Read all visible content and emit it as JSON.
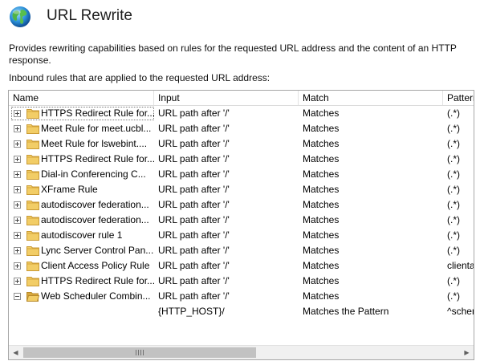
{
  "header": {
    "title": "URL Rewrite"
  },
  "description": "Provides rewriting capabilities based on rules for the requested URL address and the content of an HTTP response.",
  "inbound_label": "Inbound rules that are applied to the requested URL address:",
  "columns": {
    "name": "Name",
    "input": "Input",
    "match": "Match",
    "pattern": "Pattern"
  },
  "rules": [
    {
      "name": "HTTPS Redirect Rule for...",
      "input": "URL path after '/'",
      "match": "Matches",
      "pattern": "(.*)",
      "expander": "plus",
      "selected": true
    },
    {
      "name": "Meet Rule for meet.ucbl...",
      "input": "URL path after '/'",
      "match": "Matches",
      "pattern": "(.*)",
      "expander": "plus"
    },
    {
      "name": "Meet Rule for lswebint....",
      "input": "URL path after '/'",
      "match": "Matches",
      "pattern": "(.*)",
      "expander": "plus"
    },
    {
      "name": "HTTPS Redirect Rule for...",
      "input": "URL path after '/'",
      "match": "Matches",
      "pattern": "(.*)",
      "expander": "plus"
    },
    {
      "name": "Dial-in Conferencing C...",
      "input": "URL path after '/'",
      "match": "Matches",
      "pattern": "(.*)",
      "expander": "plus"
    },
    {
      "name": "XFrame Rule",
      "input": "URL path after '/'",
      "match": "Matches",
      "pattern": "(.*)",
      "expander": "plus"
    },
    {
      "name": "autodiscover federation...",
      "input": "URL path after '/'",
      "match": "Matches",
      "pattern": "(.*)",
      "expander": "plus"
    },
    {
      "name": "autodiscover federation...",
      "input": "URL path after '/'",
      "match": "Matches",
      "pattern": "(.*)",
      "expander": "plus"
    },
    {
      "name": "autodiscover rule 1",
      "input": "URL path after '/'",
      "match": "Matches",
      "pattern": "(.*)",
      "expander": "plus"
    },
    {
      "name": "Lync Server Control Pan...",
      "input": "URL path after '/'",
      "match": "Matches",
      "pattern": "(.*)",
      "expander": "plus"
    },
    {
      "name": "Client Access Policy Rule",
      "input": "URL path after '/'",
      "match": "Matches",
      "pattern": "clienta",
      "expander": "plus"
    },
    {
      "name": "HTTPS Redirect Rule for...",
      "input": "URL path after '/'",
      "match": "Matches",
      "pattern": "(.*)",
      "expander": "plus"
    },
    {
      "name": "Web Scheduler Combin...",
      "input": "URL path after '/'",
      "match": "Matches",
      "pattern": "(.*)",
      "expander": "minus",
      "open": true
    }
  ],
  "condition_row": {
    "input": "{HTTP_HOST}/",
    "match": "Matches the Pattern",
    "pattern": "^schem"
  },
  "colors": {
    "folder": "#f2cd66",
    "folder_dark": "#d7a73c",
    "thumb": "#c2c2c2"
  },
  "icons": {
    "header": "globe-icon",
    "folder": "folder-icon",
    "open_folder": "open-folder-icon",
    "scroll_left": "◀",
    "scroll_right": "▶",
    "scroll_grip": "grip-icon"
  }
}
